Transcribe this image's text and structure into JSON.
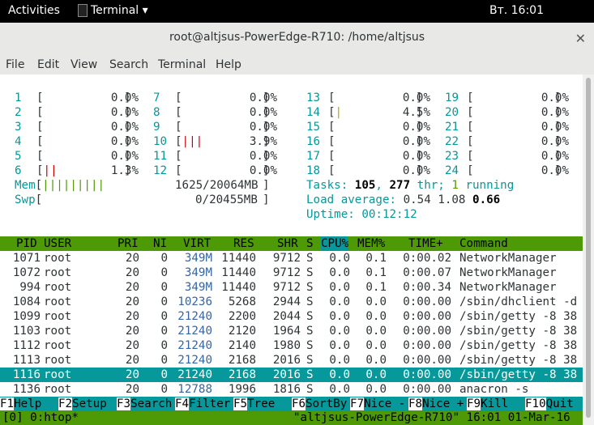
{
  "topbar": {
    "activities": "Activities",
    "app": "Terminal ▾",
    "clock": "Вт. 16:01"
  },
  "window": {
    "title": "root@altjsus-PowerEdge-R710: /home/altjsus",
    "close": "✕"
  },
  "menu": [
    "File",
    "Edit",
    "View",
    "Search",
    "Terminal",
    "Help"
  ],
  "cpus": [
    {
      "n": "1",
      "bar": "",
      "pct": "0.0%"
    },
    {
      "n": "2",
      "bar": "",
      "pct": "0.0%"
    },
    {
      "n": "3",
      "bar": "",
      "pct": "0.0%"
    },
    {
      "n": "4",
      "bar": "",
      "pct": "0.0%"
    },
    {
      "n": "5",
      "bar": "",
      "pct": "0.0%"
    },
    {
      "n": "6",
      "bar": "||",
      "pct": "1.3%"
    },
    {
      "n": "7",
      "bar": "",
      "pct": "0.0%"
    },
    {
      "n": "8",
      "bar": "",
      "pct": "0.0%"
    },
    {
      "n": "9",
      "bar": "",
      "pct": "0.0%"
    },
    {
      "n": "10",
      "bar": "|||",
      "pct": "3.9%"
    },
    {
      "n": "11",
      "bar": "",
      "pct": "0.0%"
    },
    {
      "n": "12",
      "bar": "",
      "pct": "0.0%"
    },
    {
      "n": "13",
      "bar": "",
      "pct": "0.0%"
    },
    {
      "n": "14",
      "bar": "|",
      "pct": "4.5%"
    },
    {
      "n": "15",
      "bar": "",
      "pct": "0.0%"
    },
    {
      "n": "16",
      "bar": "",
      "pct": "0.0%"
    },
    {
      "n": "17",
      "bar": "",
      "pct": "0.0%"
    },
    {
      "n": "18",
      "bar": "",
      "pct": "0.0%"
    },
    {
      "n": "19",
      "bar": "",
      "pct": "0.0%"
    },
    {
      "n": "20",
      "bar": "",
      "pct": "0.0%"
    },
    {
      "n": "21",
      "bar": "",
      "pct": "0.0%"
    },
    {
      "n": "22",
      "bar": "",
      "pct": "0.0%"
    },
    {
      "n": "23",
      "bar": "",
      "pct": "0.0%"
    },
    {
      "n": "24",
      "bar": "",
      "pct": "0.0%"
    }
  ],
  "mem": {
    "label": "Mem",
    "bar": "|||||||||",
    "value": "1625/20064MB"
  },
  "swp": {
    "label": "Swp",
    "bar": "",
    "value": "0/20455MB"
  },
  "tasks": {
    "label": "Tasks: ",
    "count": "105",
    "sep": ", ",
    "thr": "277",
    "thr_label": " thr; ",
    "running": "1",
    "running_label": " running"
  },
  "load": {
    "label": "Load average: ",
    "l1": "0.54",
    "l5": "1.08",
    "l15": "0.66"
  },
  "uptime": {
    "label": "Uptime: ",
    "value": "00:12:12"
  },
  "columns": [
    "PID",
    "USER",
    "PRI",
    "NI",
    "VIRT",
    "RES",
    "SHR",
    "S",
    "CPU%",
    "MEM%",
    "TIME+",
    "Command"
  ],
  "processes": [
    {
      "pid": "1071",
      "user": "root",
      "pri": "20",
      "ni": "0",
      "virt": "349M",
      "res": "11440",
      "shr": "9712",
      "s": "S",
      "cpu": "0.0",
      "mem": "0.1",
      "time": "0:00.02",
      "cmd": "NetworkManager"
    },
    {
      "pid": "1072",
      "user": "root",
      "pri": "20",
      "ni": "0",
      "virt": "349M",
      "res": "11440",
      "shr": "9712",
      "s": "S",
      "cpu": "0.0",
      "mem": "0.1",
      "time": "0:00.07",
      "cmd": "NetworkManager"
    },
    {
      "pid": "994",
      "user": "root",
      "pri": "20",
      "ni": "0",
      "virt": "349M",
      "res": "11440",
      "shr": "9712",
      "s": "S",
      "cpu": "0.0",
      "mem": "0.1",
      "time": "0:00.34",
      "cmd": "NetworkManager"
    },
    {
      "pid": "1084",
      "user": "root",
      "pri": "20",
      "ni": "0",
      "virt": "10236",
      "res": "5268",
      "shr": "2944",
      "s": "S",
      "cpu": "0.0",
      "mem": "0.0",
      "time": "0:00.00",
      "cmd": "/sbin/dhclient -d"
    },
    {
      "pid": "1099",
      "user": "root",
      "pri": "20",
      "ni": "0",
      "virt": "21240",
      "res": "2200",
      "shr": "2044",
      "s": "S",
      "cpu": "0.0",
      "mem": "0.0",
      "time": "0:00.00",
      "cmd": "/sbin/getty -8 38"
    },
    {
      "pid": "1103",
      "user": "root",
      "pri": "20",
      "ni": "0",
      "virt": "21240",
      "res": "2120",
      "shr": "1964",
      "s": "S",
      "cpu": "0.0",
      "mem": "0.0",
      "time": "0:00.00",
      "cmd": "/sbin/getty -8 38"
    },
    {
      "pid": "1112",
      "user": "root",
      "pri": "20",
      "ni": "0",
      "virt": "21240",
      "res": "2140",
      "shr": "1980",
      "s": "S",
      "cpu": "0.0",
      "mem": "0.0",
      "time": "0:00.00",
      "cmd": "/sbin/getty -8 38"
    },
    {
      "pid": "1113",
      "user": "root",
      "pri": "20",
      "ni": "0",
      "virt": "21240",
      "res": "2168",
      "shr": "2016",
      "s": "S",
      "cpu": "0.0",
      "mem": "0.0",
      "time": "0:00.00",
      "cmd": "/sbin/getty -8 38"
    },
    {
      "pid": "1116",
      "user": "root",
      "pri": "20",
      "ni": "0",
      "virt": "21240",
      "res": "2168",
      "shr": "2016",
      "s": "S",
      "cpu": "0.0",
      "mem": "0.0",
      "time": "0:00.00",
      "cmd": "/sbin/getty -8 38",
      "selected": true
    },
    {
      "pid": "1136",
      "user": "root",
      "pri": "20",
      "ni": "0",
      "virt": "12788",
      "res": "1996",
      "shr": "1816",
      "s": "S",
      "cpu": "0.0",
      "mem": "0.0",
      "time": "0:00.00",
      "cmd": "anacron -s"
    }
  ],
  "fkeys": [
    {
      "key": "F1",
      "label": "Help"
    },
    {
      "key": "F2",
      "label": "Setup"
    },
    {
      "key": "F3",
      "label": "Search"
    },
    {
      "key": "F4",
      "label": "Filter"
    },
    {
      "key": "F5",
      "label": "Tree"
    },
    {
      "key": "F6",
      "label": "SortBy"
    },
    {
      "key": "F7",
      "label": "Nice -"
    },
    {
      "key": "F8",
      "label": "Nice +"
    },
    {
      "key": "F9",
      "label": "Kill"
    },
    {
      "key": "F10",
      "label": "Quit"
    }
  ],
  "tmux": {
    "left": "[0] 0:htop*",
    "right": "\"altjsus-PowerEdge-R710\" 16:01 01-Mar-16"
  }
}
